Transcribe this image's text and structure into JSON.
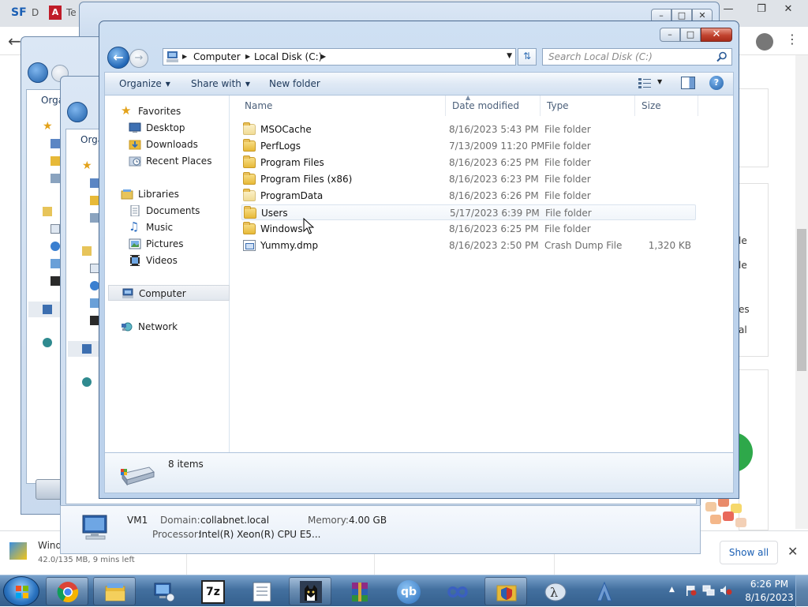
{
  "browser": {
    "tab_sf": "SF",
    "tab_d": "D",
    "tab_t": "Te",
    "card_texts": [
      "le",
      "le",
      "es",
      "al"
    ]
  },
  "download_bar": {
    "item_name": "Wind",
    "item_status": "42.0/135 MB, 9 mins left",
    "show_all_label": "Show all"
  },
  "background_windows": {
    "organize_partial": "Orga"
  },
  "system_info": {
    "computer_name": "VM1",
    "domain_label": "Domain:",
    "domain_value": "collabnet.local",
    "memory_label": "Memory:",
    "memory_value": "4.00 GB",
    "processor_label": "Processor:",
    "processor_value": "Intel(R) Xeon(R) CPU E5..."
  },
  "explorer": {
    "address": {
      "crumbs": [
        "Computer",
        "Local Disk (C:)"
      ]
    },
    "search_placeholder": "Search Local Disk (C:)",
    "commands": {
      "organize": "Organize",
      "share_with": "Share with",
      "new_folder": "New folder"
    },
    "nav": {
      "favorites": "Favorites",
      "desktop": "Desktop",
      "downloads": "Downloads",
      "recent_places": "Recent Places",
      "libraries": "Libraries",
      "documents": "Documents",
      "music": "Music",
      "pictures": "Pictures",
      "videos": "Videos",
      "computer": "Computer",
      "network": "Network"
    },
    "columns": {
      "name": "Name",
      "date_modified": "Date modified",
      "type": "Type",
      "size": "Size"
    },
    "files": [
      {
        "name": "MSOCache",
        "date": "8/16/2023 5:43 PM",
        "type": "File folder",
        "size": "",
        "icon": "folder-pale"
      },
      {
        "name": "PerfLogs",
        "date": "7/13/2009 11:20 PM",
        "type": "File folder",
        "size": "",
        "icon": "folder"
      },
      {
        "name": "Program Files",
        "date": "8/16/2023 6:25 PM",
        "type": "File folder",
        "size": "",
        "icon": "folder"
      },
      {
        "name": "Program Files (x86)",
        "date": "8/16/2023 6:23 PM",
        "type": "File folder",
        "size": "",
        "icon": "folder"
      },
      {
        "name": "ProgramData",
        "date": "8/16/2023 6:26 PM",
        "type": "File folder",
        "size": "",
        "icon": "folder-pale"
      },
      {
        "name": "Users",
        "date": "5/17/2023 6:39 PM",
        "type": "File folder",
        "size": "",
        "icon": "folder"
      },
      {
        "name": "Windows",
        "date": "8/16/2023 6:25 PM",
        "type": "File folder",
        "size": "",
        "icon": "folder"
      },
      {
        "name": "Yummy.dmp",
        "date": "8/16/2023 2:50 PM",
        "type": "Crash Dump File",
        "size": "1,320 KB",
        "icon": "dump-file"
      }
    ],
    "item_count": "8 items"
  },
  "taskbar": {
    "apps": [
      "chrome",
      "file-explorer",
      "remote-desktop",
      "7-zip",
      "notepad",
      "cat-app",
      "winrar",
      "qbittorrent",
      "infinity-app",
      "folder-shield-app",
      "lambda-app",
      "pen-app"
    ],
    "apps_labels": {
      "seven_zip": "7z",
      "qbittorrent": "qb"
    },
    "clock_time": "6:26 PM",
    "clock_date": "8/16/2023"
  },
  "colors": {
    "accent": "#2166b6",
    "selection": "#e2e7ee"
  }
}
